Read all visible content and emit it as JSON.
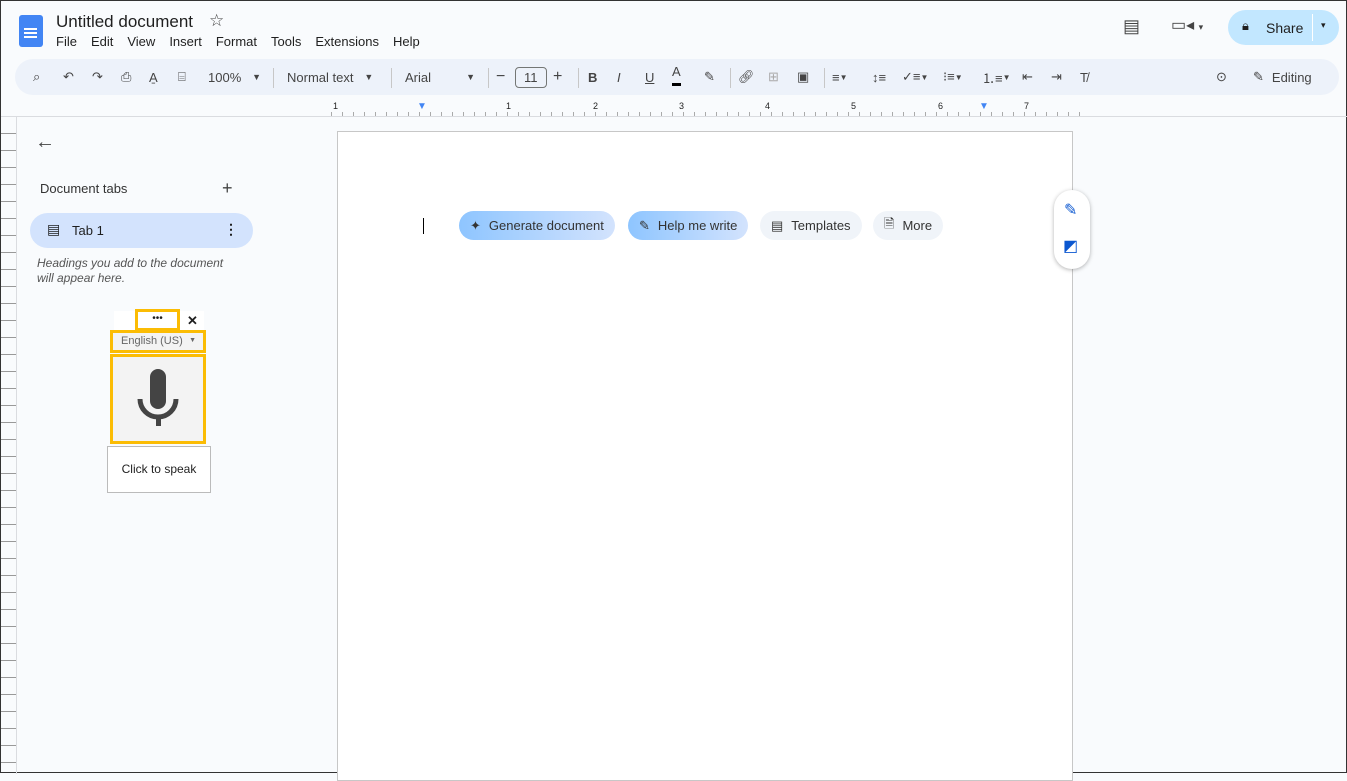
{
  "header": {
    "title": "Untitled document",
    "menu": [
      "File",
      "Edit",
      "View",
      "Insert",
      "Format",
      "Tools",
      "Extensions",
      "Help"
    ],
    "share_label": "Share"
  },
  "toolbar": {
    "zoom": "100%",
    "style": "Normal text",
    "font": "Arial",
    "font_size": "11",
    "mode": "Editing"
  },
  "ruler": {
    "labels": [
      "1",
      "1",
      "2",
      "3",
      "4",
      "5",
      "6",
      "7"
    ]
  },
  "sidebar": {
    "title": "Document tabs",
    "tab_label": "Tab 1",
    "hint": "Headings you add to the document will appear here."
  },
  "voice": {
    "more": "•••",
    "close": "✕",
    "language": "English (US)",
    "tooltip": "Click to speak"
  },
  "chips": [
    {
      "label": "Generate document",
      "icon": "sparkle-icon"
    },
    {
      "label": "Help me write",
      "icon": "magic-pen-icon"
    },
    {
      "label": "Templates",
      "icon": "template-icon"
    },
    {
      "label": "More",
      "icon": "add-doc-icon"
    }
  ],
  "colors": {
    "accent": "#0b57d0",
    "share_bg": "#c2e7ff",
    "tab_bg": "#d3e3fd",
    "highlight": "#fbbc04"
  }
}
